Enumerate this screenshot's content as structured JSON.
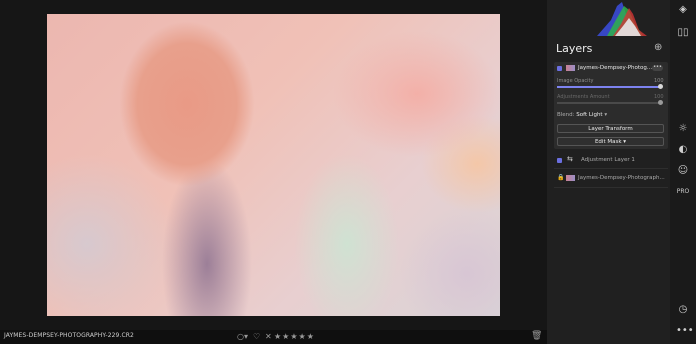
{
  "status_bar": {
    "filename": "JAYMES-DEMPSEY-PHOTOGRAPHY-229.CR2",
    "rating_stars": 0
  },
  "layers_panel": {
    "title": "Layers",
    "add_icon": "plus-icon",
    "active_layer": {
      "name": "Jaymes-Dempsey-Photog...",
      "checked": true,
      "image_opacity_label": "Image Opacity",
      "image_opacity_value": "100",
      "adjustments_amount_label": "Adjustments Amount",
      "adjustments_amount_value": "100",
      "blend_label": "Blend:",
      "blend_value": "Soft Light",
      "layer_transform_label": "Layer Transform",
      "edit_mask_label": "Edit Mask"
    },
    "adjustment_layer": {
      "name": "Adjustment Layer 1",
      "checked": true
    },
    "base_layer": {
      "name": "Jaymes-Dempsey-Photograph...",
      "locked": true
    }
  },
  "right_rail": {
    "icons": [
      "layers-icon",
      "compare-icon",
      "sun-icon",
      "palette-icon",
      "face-icon",
      "pro-icon",
      "history-icon",
      "more-icon"
    ],
    "pro_label": "PRO"
  },
  "colors": {
    "accent": "#6b6fe0",
    "panel_bg": "#202020",
    "canvas_bg": "#161616"
  }
}
